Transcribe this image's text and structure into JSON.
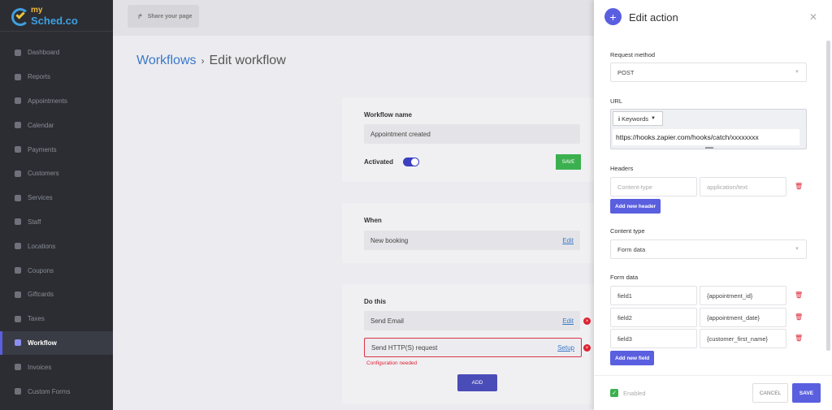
{
  "logo": {
    "line1": "my",
    "line2": "Sched.co"
  },
  "sidebar": {
    "items": [
      {
        "label": "Dashboard"
      },
      {
        "label": "Reports"
      },
      {
        "label": "Appointments"
      },
      {
        "label": "Calendar"
      },
      {
        "label": "Payments"
      },
      {
        "label": "Customers"
      },
      {
        "label": "Services"
      },
      {
        "label": "Staff"
      },
      {
        "label": "Locations"
      },
      {
        "label": "Coupons"
      },
      {
        "label": "Giftcards"
      },
      {
        "label": "Taxes"
      },
      {
        "label": "Workflow",
        "active": true
      },
      {
        "label": "Invoices"
      },
      {
        "label": "Custom Forms"
      }
    ]
  },
  "topbar": {
    "share_label": "Share your page"
  },
  "breadcrumb": {
    "parent": "Workflows",
    "separator": "›",
    "current": "Edit workflow"
  },
  "workflow_card": {
    "name_label": "Workflow name",
    "name_value": "Appointment created",
    "activated_label": "Activated",
    "save_label": "SAVE"
  },
  "when_card": {
    "title": "When",
    "trigger": "New booking",
    "edit_label": "Edit"
  },
  "do_card": {
    "title": "Do this",
    "actions": [
      {
        "label": "Send Email",
        "link": "Edit"
      },
      {
        "label": "Send HTTP(S) request",
        "link": "Setup",
        "error": "Configuration needed"
      }
    ],
    "add_label": "ADD"
  },
  "panel": {
    "title": "Edit action",
    "request_method_label": "Request method",
    "request_method_value": "POST",
    "url_label": "URL",
    "keywords_label": "Keywords",
    "url_value": "https://hooks.zapier.com/hooks/catch/xxxxxxxx",
    "headers_label": "Headers",
    "header_key_placeholder": "Content-type",
    "header_value_placeholder": "application/text",
    "add_header_label": "Add new header",
    "content_type_label": "Content type",
    "content_type_value": "Form data",
    "form_data_label": "Form data",
    "form_fields": [
      {
        "key": "field1",
        "value": "{appointment_id}"
      },
      {
        "key": "field2",
        "value": "{appointment_date}"
      },
      {
        "key": "field3",
        "value": "{customer_first_name}"
      }
    ],
    "add_field_label": "Add new field",
    "enabled_label": "Enabled",
    "cancel_label": "CANCEL",
    "save_label": "SAVE"
  },
  "colors": {
    "accent": "#5a5fe0",
    "success": "#3cb04f",
    "danger": "#dd2233",
    "sidebar_bg": "#2b2d33"
  }
}
